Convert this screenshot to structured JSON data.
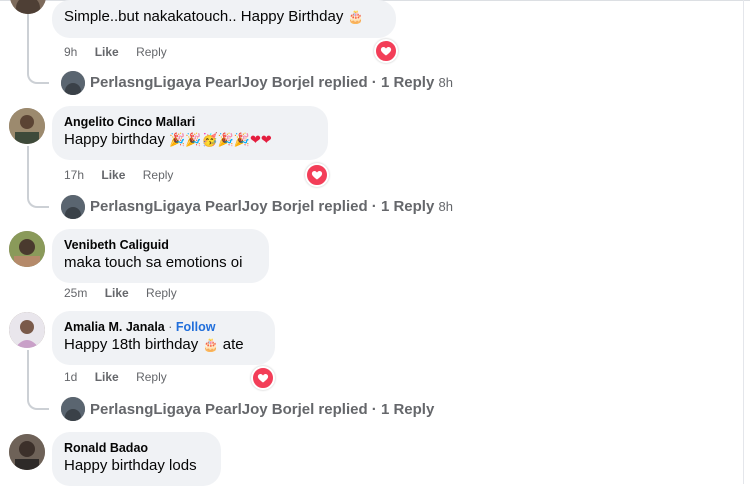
{
  "comments": [
    {
      "author": "",
      "text": "Simple..but nakakatouch.. Happy Birthday",
      "emoji": "🎂",
      "time": "9h",
      "like": "Like",
      "reply": "Reply",
      "replies_summary": {
        "name": "PerlasngLigaya PearlJoy Borjel replied",
        "count": "· 1 Reply",
        "time": "8h"
      }
    },
    {
      "author": "Angelito Cinco Mallari",
      "text": "Happy birthday",
      "emoji": "🎉🎉🥳🎉🎉❤❤",
      "time": "17h",
      "like": "Like",
      "reply": "Reply",
      "replies_summary": {
        "name": "PerlasngLigaya PearlJoy Borjel replied",
        "count": "· 1 Reply",
        "time": "8h"
      }
    },
    {
      "author": "Venibeth Caliguid",
      "text": "maka touch sa emotions oi",
      "time": "25m",
      "like": "Like",
      "reply": "Reply"
    },
    {
      "author": "Amalia M. Janala",
      "follow_sep": "·",
      "follow": "Follow",
      "text": "Happy 18th birthday",
      "emoji": "🎂",
      "text_after": "ate",
      "time": "1d",
      "like": "Like",
      "reply": "Reply",
      "replies_summary": {
        "name": "PerlasngLigaya PearlJoy Borjel replied",
        "count": "· 1 Reply"
      }
    },
    {
      "author": "Ronald Badao",
      "text": "Happy birthday lods"
    }
  ],
  "colors": {
    "reaction": "#f33e58",
    "follow": "#216fdb",
    "meta": "#65676b",
    "bubble": "#f0f2f5"
  },
  "icons": {
    "reaction": "heart-reaction-icon"
  }
}
